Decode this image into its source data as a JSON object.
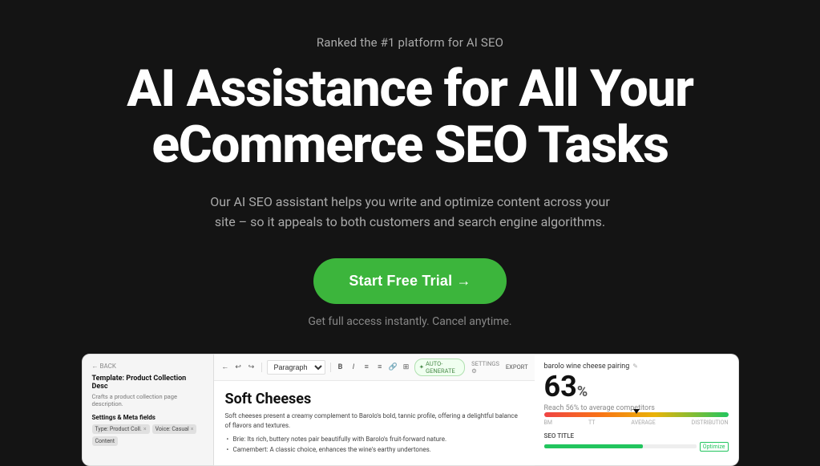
{
  "hero": {
    "badge": "Ranked the #1 platform for AI SEO",
    "heading_line1": "AI Assistance for All Your",
    "heading_line2": "eCommerce SEO Tasks",
    "subtitle": "Our AI SEO assistant helps you write and optimize content across your site – so it appeals to both customers and search engine algorithms.",
    "cta_label": "Start Free Trial →",
    "cta_sub": "Get full access instantly. Cancel anytime."
  },
  "preview": {
    "left_panel": {
      "back": "← BACK",
      "title": "Template: Product Collection Desc",
      "subtitle": "Crafts a product collection page description.",
      "section": "Settings & Meta fields",
      "tags": [
        {
          "label": "Product Coll.",
          "closable": true
        },
        {
          "label": "Voice: Casual",
          "closable": true
        },
        {
          "label": "Content",
          "closable": false
        }
      ]
    },
    "editor": {
      "toolbar": {
        "back": "←",
        "undo": "↩",
        "redo": "↪",
        "style": "Paragraph",
        "bold": "B",
        "italic": "I",
        "list_ul": "≡",
        "list_ol": "≡",
        "link": "🔗",
        "table": "⊞",
        "auto_generate": "AUTO-GENERATE",
        "settings": "SETTINGS ⚙",
        "export": "EXPORT"
      },
      "heading": "Soft Cheeses",
      "paragraph": "Soft cheeses present a creamy complement to Barolo's bold, tannic profile, offering a delightful balance of flavors and textures.",
      "bullet1": "Brie: Its rich, buttery notes pair beautifully with Barolo's fruit-forward nature.",
      "bullet2": "Camembert: A classic choice, enhances the wine's earthy undertones."
    },
    "analytics": {
      "title": "barolo wine cheese pairing",
      "score": "63",
      "score_label": "Reach 56% to average competitors",
      "seo_title_label": "SEO TITLE",
      "optimize_label": "Optimize"
    }
  }
}
